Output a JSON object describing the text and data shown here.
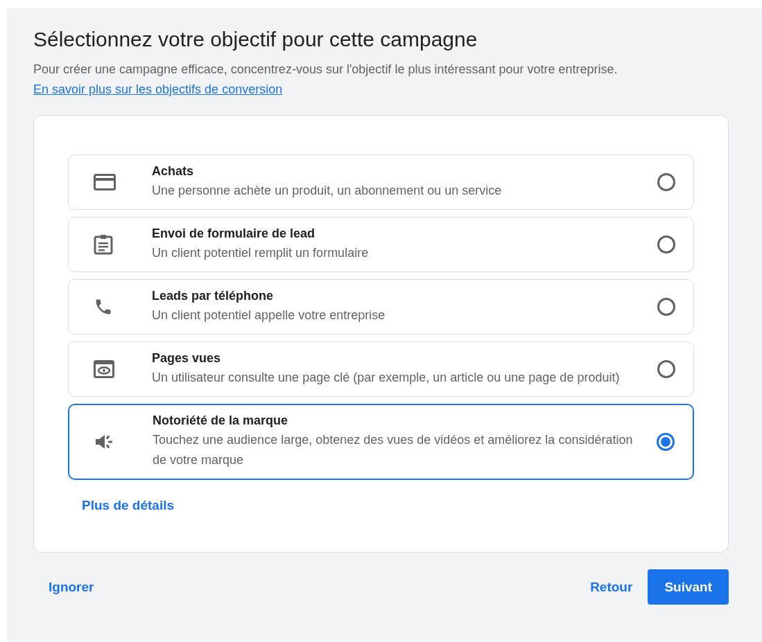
{
  "title": "Sélectionnez votre objectif pour cette campagne",
  "description": {
    "text": "Pour créer une campagne efficace, concentrez-vous sur l'objectif le plus intéressant pour votre entreprise.",
    "link": "En savoir plus sur les objectifs de conversion"
  },
  "options": [
    {
      "kind": "card",
      "title": "Achats",
      "description": "Une personne achète un produit, un abonnement ou un service",
      "selected": false
    },
    {
      "kind": "form",
      "title": "Envoi de formulaire de lead",
      "description": "Un client potentiel remplit un formulaire",
      "selected": false
    },
    {
      "kind": "phone",
      "title": "Leads par téléphone",
      "description": "Un client potentiel appelle votre entreprise",
      "selected": false
    },
    {
      "kind": "view",
      "title": "Pages vues",
      "description": "Un utilisateur consulte une page clé (par exemple, un article ou une page de produit)",
      "selected": false
    },
    {
      "kind": "speaker",
      "title": "Notoriété de la marque",
      "description": "Touchez une audience large, obtenez des vues de vidéos et améliorez la considération de votre marque",
      "selected": true
    }
  ],
  "more_link": "Plus de détails",
  "footer": {
    "skip": "Ignorer",
    "back": "Retour",
    "next": "Suivant"
  }
}
